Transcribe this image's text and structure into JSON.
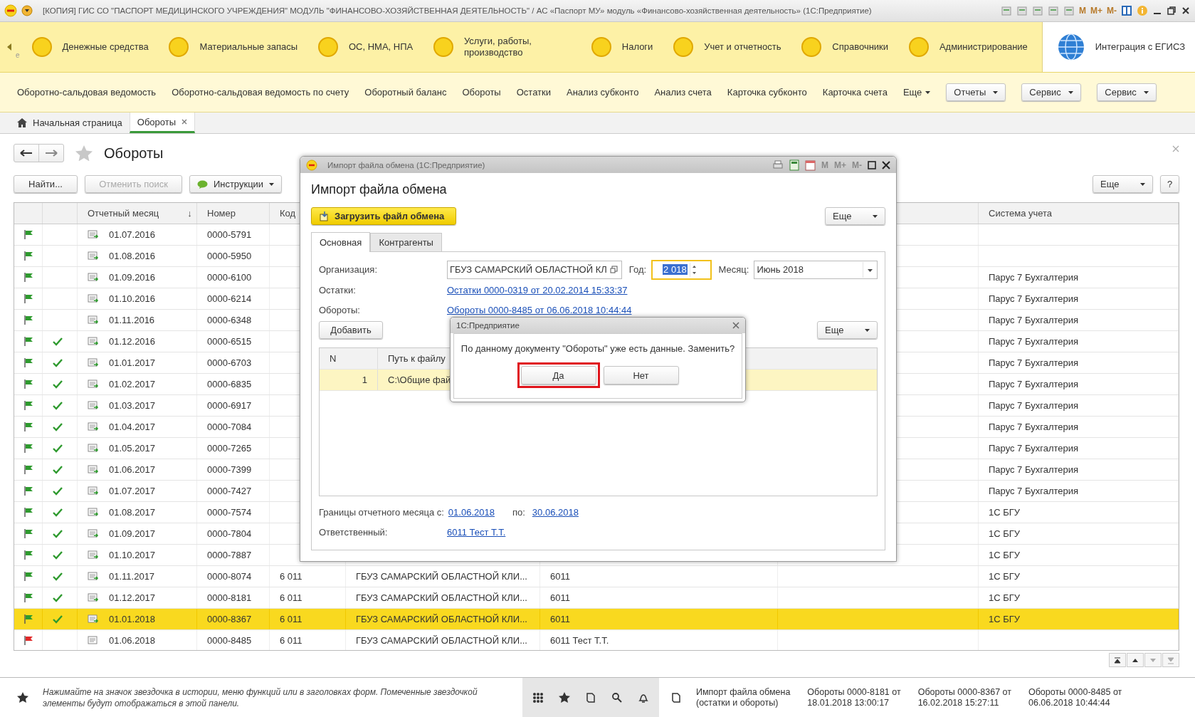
{
  "title_bar": {
    "title": "[КОПИЯ] ГИС СО \"ПАСПОРТ МЕДИЦИНСКОГО УЧРЕЖДЕНИЯ\" МОДУЛЬ \"ФИНАНСОВО-ХОЗЯЙСТВЕННАЯ ДЕЯТЕЛЬНОСТЬ\" / АС «Паспорт МУ» модуль «Финансово-хозяйственная деятельность»  (1С:Предприятие)",
    "memory_buttons": [
      "M",
      "M+",
      "M-"
    ]
  },
  "sections_fragment": "е",
  "sections": [
    {
      "label": "Денежные средства",
      "kind": "circle",
      "selected": false
    },
    {
      "label": "Материальные запасы",
      "kind": "circle",
      "selected": false
    },
    {
      "label": "ОС, НМА, НПА",
      "kind": "circle",
      "selected": false
    },
    {
      "label": "Услуги, работы, производство",
      "kind": "circle",
      "selected": false
    },
    {
      "label": "Налоги",
      "kind": "circle",
      "selected": false
    },
    {
      "label": "Учет и отчетность",
      "kind": "circle",
      "selected": false
    },
    {
      "label": "Справочники",
      "kind": "circle",
      "selected": false
    },
    {
      "label": "Администрирование",
      "kind": "circle",
      "selected": false
    },
    {
      "label": "Интеграция с ЕГИСЗ",
      "kind": "globe",
      "selected": true
    }
  ],
  "function_bar": {
    "links": [
      "Оборотно-сальдовая ведомость",
      "Оборотно-сальдовая ведомость по счету",
      "Оборотный баланс",
      "Обороты",
      "Остатки",
      "Анализ субконто",
      "Анализ счета",
      "Карточка субконто",
      "Карточка счета"
    ],
    "more": "Еще",
    "buttons": [
      "Отчеты",
      "Сервис",
      "Сервис"
    ]
  },
  "open_tabs": [
    {
      "label": "Начальная страница",
      "kind": "home",
      "selected": false
    },
    {
      "label": "Обороты",
      "kind": "closable",
      "selected": true
    }
  ],
  "form": {
    "title": "Обороты",
    "find": "Найти...",
    "cancel_search": {
      "label": "Отменить поиск",
      "disabled": true
    },
    "instructions": "Инструкции",
    "more": "Еще",
    "help": "?"
  },
  "table": {
    "columns": [
      {
        "label": "Отчетный месяц",
        "sort_mark": "↓"
      },
      {
        "label": "Номер"
      },
      {
        "label": "Код"
      },
      {
        "label": "Система учета"
      }
    ],
    "rows": [
      {
        "color": "#2e9a2e",
        "checked": false,
        "posted": true,
        "month": "01.07.2016",
        "number": "0000-5791",
        "selected": false
      },
      {
        "color": "#2e9a2e",
        "checked": false,
        "posted": true,
        "month": "01.08.2016",
        "number": "0000-5950",
        "selected": false
      },
      {
        "color": "#2e9a2e",
        "checked": false,
        "posted": true,
        "month": "01.09.2016",
        "number": "0000-6100",
        "system": "Парус 7 Бухгалтерия",
        "selected": false
      },
      {
        "color": "#2e9a2e",
        "checked": false,
        "posted": true,
        "month": "01.10.2016",
        "number": "0000-6214",
        "system": "Парус 7 Бухгалтерия",
        "selected": false
      },
      {
        "color": "#2e9a2e",
        "checked": false,
        "posted": true,
        "month": "01.11.2016",
        "number": "0000-6348",
        "system": "Парус 7 Бухгалтерия",
        "selected": false
      },
      {
        "color": "#2e9a2e",
        "checked": true,
        "posted": true,
        "month": "01.12.2016",
        "number": "0000-6515",
        "system": "Парус 7 Бухгалтерия",
        "selected": false
      },
      {
        "color": "#2e9a2e",
        "checked": true,
        "posted": true,
        "month": "01.01.2017",
        "number": "0000-6703",
        "system": "Парус 7 Бухгалтерия",
        "selected": false
      },
      {
        "color": "#2e9a2e",
        "checked": true,
        "posted": true,
        "month": "01.02.2017",
        "number": "0000-6835",
        "system": "Парус 7 Бухгалтерия",
        "selected": false
      },
      {
        "color": "#2e9a2e",
        "checked": true,
        "posted": true,
        "month": "01.03.2017",
        "number": "0000-6917",
        "system": "Парус 7 Бухгалтерия",
        "selected": false
      },
      {
        "color": "#2e9a2e",
        "checked": true,
        "posted": true,
        "month": "01.04.2017",
        "number": "0000-7084",
        "system": "Парус 7 Бухгалтерия",
        "selected": false
      },
      {
        "color": "#2e9a2e",
        "checked": true,
        "posted": true,
        "month": "01.05.2017",
        "number": "0000-7265",
        "system": "Парус 7 Бухгалтерия",
        "selected": false
      },
      {
        "color": "#2e9a2e",
        "checked": true,
        "posted": true,
        "month": "01.06.2017",
        "number": "0000-7399",
        "system": "Парус 7 Бухгалтерия",
        "selected": false
      },
      {
        "color": "#2e9a2e",
        "checked": true,
        "posted": true,
        "month": "01.07.2017",
        "number": "0000-7427",
        "system": "Парус 7 Бухгалтерия",
        "selected": false
      },
      {
        "color": "#2e9a2e",
        "checked": true,
        "posted": true,
        "month": "01.08.2017",
        "number": "0000-7574",
        "system": "1С БГУ",
        "selected": false
      },
      {
        "color": "#2e9a2e",
        "checked": true,
        "posted": true,
        "month": "01.09.2017",
        "number": "0000-7804",
        "system": "1С БГУ",
        "selected": false
      },
      {
        "color": "#2e9a2e",
        "checked": true,
        "posted": true,
        "month": "01.10.2017",
        "number": "0000-7887",
        "system": "1С БГУ",
        "selected": false
      },
      {
        "color": "#2e9a2e",
        "checked": true,
        "posted": true,
        "month": "01.11.2017",
        "number": "0000-8074",
        "code": "6 011",
        "organization": "ГБУЗ САМАРСКИЙ ОБЛАСТНОЙ КЛИ...",
        "responsible": "6011",
        "system": "1С БГУ",
        "selected": false
      },
      {
        "color": "#2e9a2e",
        "checked": true,
        "posted": true,
        "month": "01.12.2017",
        "number": "0000-8181",
        "code": "6 011",
        "organization": "ГБУЗ САМАРСКИЙ ОБЛАСТНОЙ КЛИ...",
        "responsible": "6011",
        "system": "1С БГУ",
        "selected": false
      },
      {
        "color": "#2e9a2e",
        "checked": true,
        "posted": true,
        "month": "01.01.2018",
        "number": "0000-8367",
        "code": "6 011",
        "organization": "ГБУЗ САМАРСКИЙ ОБЛАСТНОЙ КЛИ...",
        "responsible": "6011",
        "system": "1С БГУ",
        "selected": true
      },
      {
        "color": "#e02828",
        "checked": false,
        "posted": false,
        "month": "01.06.2018",
        "number": "0000-8485",
        "code": "6 011",
        "organization": "ГБУЗ САМАРСКИЙ ОБЛАСТНОЙ КЛИ...",
        "responsible": "6011 Тест Т.Т.",
        "selected": false
      }
    ]
  },
  "modal": {
    "title": "Импорт файла обмена  (1С:Предприятие)",
    "memory_buttons": [
      "M",
      "M+",
      "M-"
    ],
    "heading": "Импорт файла обмена",
    "load_button": "Загрузить файл обмена",
    "more": "Еще",
    "tabs": [
      {
        "label": "Основная",
        "selected": true
      },
      {
        "label": "Контрагенты",
        "selected": false
      }
    ],
    "organization_label": "Организация:",
    "organization": "ГБУЗ САМАРСКИЙ ОБЛАСТНОЙ КЛ",
    "year_label": "Год:",
    "year": "2 018",
    "month_label": "Месяц:",
    "month": "Июнь 2018",
    "balances_label": "Остатки:",
    "balances_link": "Остатки 0000-0319 от 20.02.2014 15:33:37",
    "turnover_label": "Обороты:",
    "turnover_link": "Обороты 0000-8485 от 06.06.2018 10:44:44",
    "add_button": "Добавить",
    "list_more": "Еще",
    "list_columns": [
      "N",
      "Путь к файлу"
    ],
    "list_rows": [
      {
        "n": "1",
        "path": "C:\\Общие фай",
        "selected": true
      }
    ],
    "period_label": "Границы отчетного месяца с:",
    "period_from": "01.06.2018",
    "period_to_label": "по:",
    "period_to": "30.06.2018",
    "responsible_label": "Ответственный:",
    "responsible": "6011 Тест Т.Т."
  },
  "dialog": {
    "title": "1С:Предприятие",
    "message": "По данному документу \"Обороты\" уже есть данные. Заменить?",
    "buttons": [
      {
        "label": "Да",
        "highlighted": true
      },
      {
        "label": "Нет",
        "highlighted": false
      }
    ]
  },
  "favorites_panel": {
    "hint": "Нажимайте на значок звездочка в истории, меню функций или в заголовках форм. Помеченные звездочкой элементы будут отображаться в этой панели.",
    "history": [
      [
        "Импорт файла обмена",
        "(остатки и обороты)"
      ],
      [
        "Обороты 0000-8181 от",
        "18.01.2018 13:00:17"
      ],
      [
        "Обороты 0000-8367 от",
        "16.02.2018 15:27:11"
      ],
      [
        "Обороты 0000-8485 от",
        "06.06.2018 10:44:44"
      ]
    ]
  }
}
